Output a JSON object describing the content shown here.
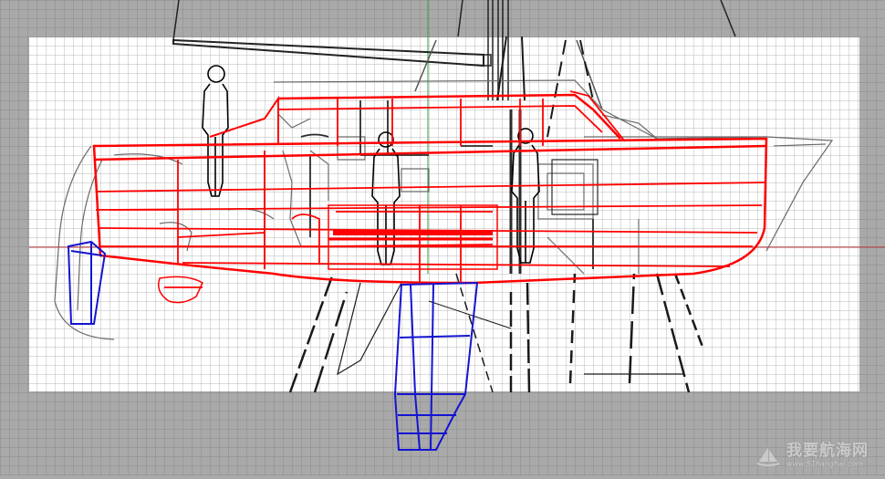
{
  "viewport": {
    "background": "#a9a9a9",
    "sheet_color": "#ffffff",
    "grid_color": "#8c8c8c",
    "axis_x_color": "#c43a3a",
    "axis_y_color": "#2fa33a"
  },
  "colors": {
    "hull_structure": "#ff0000",
    "keel_rudder": "#1414d2",
    "underlay_lines": "#3a3a3a",
    "figures": "#000000"
  },
  "watermark": {
    "icon": "sailboat-logo-icon",
    "brand_text": "我要航海网",
    "url_text": "www.51hanghai.com"
  }
}
